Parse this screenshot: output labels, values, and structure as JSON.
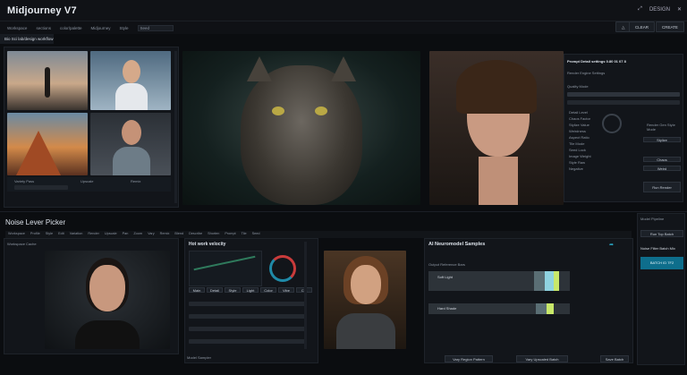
{
  "app": {
    "title": "Midjourney V7"
  },
  "titlebar": {
    "btn_a": "DESIGN",
    "icons": [
      "share-icon",
      "close-icon"
    ]
  },
  "toolbar": {
    "items": [
      "Workspace",
      "sections",
      "color/palette",
      "Midjourney",
      "Style",
      "Seed"
    ],
    "right_buttons": [
      "CLEAR",
      "CREATE"
    ]
  },
  "subtab": {
    "label": "Bio Sci lab/design workflow"
  },
  "gallery": {
    "row_labels": [
      "Variety Pass",
      "Upscale",
      "Remix"
    ]
  },
  "settings": {
    "header": "Prompt Detail settings 0.80 01 07 8",
    "sub": "Render Engine Settings",
    "title2": "Quality Mode",
    "list": [
      "Detail Level",
      "Chaos Factor",
      "Stylize Value",
      "Weirdness",
      "Aspect Ratio",
      "Tile Mode",
      "Seed Lock",
      "Image Weight",
      "Style Raw",
      "Negative"
    ],
    "right_label": "Render Gen Style Mode",
    "right_items": [
      "Stylize",
      "Chaos",
      "Weird"
    ],
    "btn": "Run Render"
  },
  "lower": {
    "title": "Noise Lever Picker",
    "tabs": [
      "Workspace",
      "Profile",
      "Style",
      "Edit",
      "Variation",
      "Render",
      "Upscale",
      "Pan",
      "Zoom",
      "Vary",
      "Remix",
      "Blend",
      "Describe",
      "Shorten",
      "Prompt",
      "Tile",
      "Seed"
    ],
    "left_label": "Workspace Cache",
    "mid_title": "Hot work velocity",
    "mid_btns": [
      "Main",
      "Detail",
      "Style",
      "Light",
      "Color",
      "Vibe",
      "Cut"
    ],
    "right_title": "AI Neuromodel Samples",
    "right_label": "Output Reference Bars",
    "bar_label1": "Soft Light",
    "bar_label2": "Hard Shade",
    "foot_left": "Model Sampler",
    "foot_btns": [
      "Vary Region Pattern",
      "Vary Upscaled Batch",
      "Save Batch"
    ]
  },
  "side": {
    "label": "Model Pipeline",
    "btn": "Run Top Batch",
    "card_title": "Noise Filter Batch Mix",
    "card_value": "BATCH ID 7F2"
  },
  "colors": {
    "accent": "#0e6e8c",
    "bar1": "#5a6e74",
    "bar2": "#8fd3e0",
    "bar3": "#c8e86a"
  }
}
